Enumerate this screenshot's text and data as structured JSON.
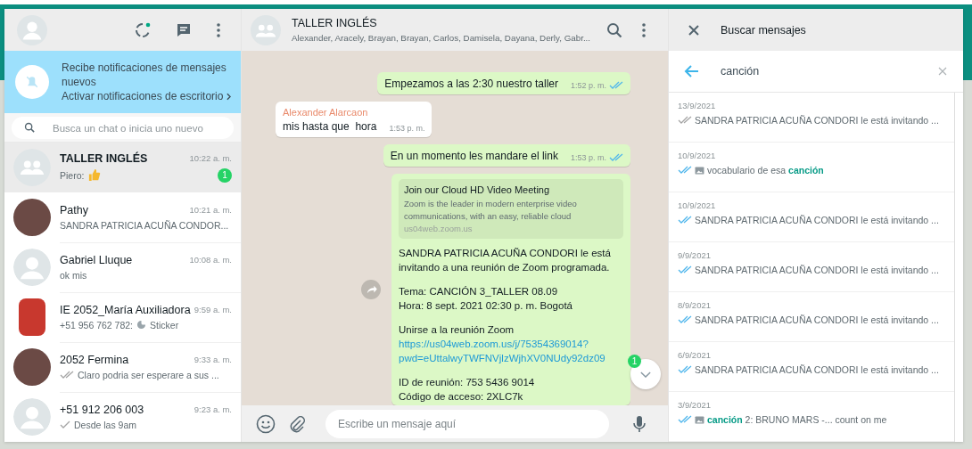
{
  "sidebar": {
    "notification": {
      "title": "Recibe notificaciones de mensajes nuevos",
      "link": "Activar notificaciones de escritorio"
    },
    "search": {
      "placeholder": "Busca un chat o inicia uno nuevo"
    },
    "chats": [
      {
        "kind": "group",
        "name": "TALLER INGLÉS",
        "time": "10:22 a. m.",
        "preview": {
          "kind": "emoji",
          "sender": "Piero:"
        },
        "unread": "1",
        "selected": true
      },
      {
        "kind": "photo",
        "name": "Pathy",
        "time": "10:21 a. m.",
        "preview": {
          "kind": "text",
          "text": "SANDRA PATRICIA ACUÑA CONDOR..."
        },
        "selected": false
      },
      {
        "kind": "default",
        "name": "Gabriel Lluque",
        "time": "10:08 a. m.",
        "preview": {
          "kind": "text",
          "text": "ok mis"
        },
        "selected": false
      },
      {
        "kind": "logo",
        "name": "IE 2052_María Auxiliadora",
        "time": "9:59 a. m.",
        "preview": {
          "kind": "sticker",
          "sender": "+51 956 762 782:",
          "text": "Sticker"
        },
        "selected": false
      },
      {
        "kind": "photo",
        "name": "2052 Fermina",
        "time": "9:33 a. m.",
        "preview": {
          "kind": "delivered",
          "text": "Claro podria ser esperare a sus ..."
        },
        "selected": false
      },
      {
        "kind": "default",
        "name": "+51 912 206 003",
        "time": "9:23 a. m.",
        "preview": {
          "kind": "sent",
          "text": "Desde las 9am"
        },
        "selected": false
      }
    ]
  },
  "chat": {
    "title": "TALLER INGLÉS",
    "members": "Alexander, Aracely, Brayan, Brayan, Carlos, Damisela, Dayana, Derly, Gabr...",
    "messages": [
      {
        "kind": "out",
        "text": "Empezamos a las 2:30 nuestro taller",
        "time": "1:52 p. m.",
        "read": true
      },
      {
        "kind": "in",
        "author": "Alexander Alarcaon",
        "text": "mis hasta que  hora",
        "time": "1:53 p. m."
      },
      {
        "kind": "out",
        "text": "En un momento les mandare el link",
        "time": "1:53 p. m.",
        "read": true
      },
      {
        "kind": "link",
        "preview": {
          "title": "Join our Cloud HD Video Meeting",
          "description": "Zoom is the leader in modern enterprise video communications, with an easy, reliable cloud",
          "domain": "us04web.zoom.us"
        },
        "paragraphs": [
          [
            {
              "text": "SANDRA PATRICIA ACUÑA CONDORI le está invitando a una reunión de Zoom programada."
            }
          ],
          [
            {
              "text": "Tema: CANCIÓN 3_TALLER 08.09"
            },
            {
              "text": "Hora: 8 sept. 2021 02:30 p. m. Bogotá"
            }
          ],
          [
            {
              "text": "Unirse a la reunión Zoom"
            },
            {
              "link": "https://us04web.zoom.us/j/75354369014?"
            },
            {
              "link": "pwd=eUttalwyTWFNVjlzWjhXV0NUdy92dz09"
            }
          ],
          [
            {
              "text": "ID de reunión: 753 5436 9014"
            },
            {
              "text": "Código de acceso: 2XLC7k"
            }
          ]
        ]
      }
    ],
    "scroll_badge": "1",
    "composer": {
      "placeholder": "Escribe un mensaje aquí"
    }
  },
  "search_panel": {
    "title": "Buscar mensajes",
    "query": "canción",
    "results": [
      {
        "date": "13/9/2021",
        "read": false,
        "media": false,
        "text": "SANDRA PATRICIA ACUÑA CONDORI le está invitando ..."
      },
      {
        "date": "10/9/2021",
        "read": true,
        "media": true,
        "text": "vocabulario de esa **canción**"
      },
      {
        "date": "10/9/2021",
        "read": true,
        "media": false,
        "text": "SANDRA PATRICIA ACUÑA CONDORI le está invitando ..."
      },
      {
        "date": "9/9/2021",
        "read": true,
        "media": false,
        "text": "SANDRA PATRICIA ACUÑA CONDORI le está invitando ..."
      },
      {
        "date": "8/9/2021",
        "read": true,
        "media": false,
        "text": "SANDRA PATRICIA ACUÑA CONDORI le está invitando ..."
      },
      {
        "date": "6/9/2021",
        "read": true,
        "media": false,
        "text": "SANDRA PATRICIA ACUÑA CONDORI le está invitando ..."
      },
      {
        "date": "3/9/2021",
        "read": true,
        "media": true,
        "text": "**canción** 2: BRUNO MARS -... count on me"
      }
    ]
  }
}
